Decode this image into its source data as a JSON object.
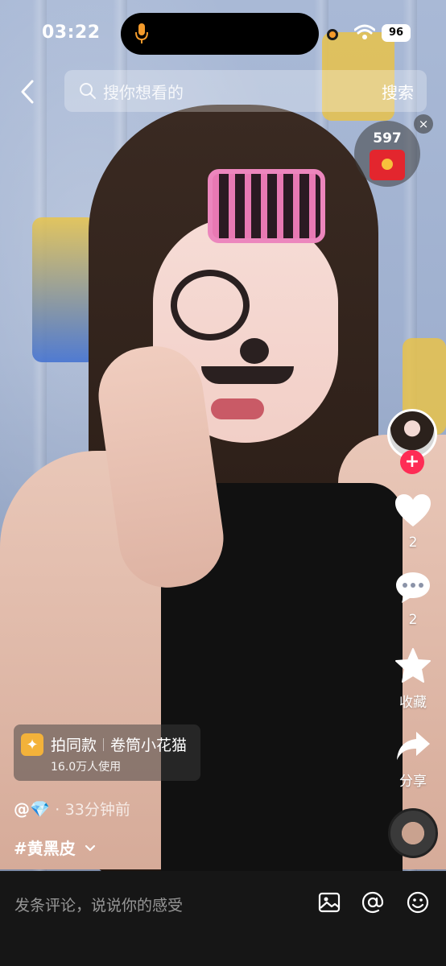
{
  "status_bar": {
    "time": "03:22",
    "battery": "96"
  },
  "search": {
    "placeholder": "搜你想看的",
    "button_label": "搜索"
  },
  "red_packet": {
    "count": "597"
  },
  "rail": {
    "like_count": "2",
    "comment_count": "2",
    "favorite_label": "收藏",
    "share_label": "分享"
  },
  "effect": {
    "title": "拍同款",
    "name": "卷筒小花猫",
    "users": "16.0万人使用"
  },
  "author": {
    "name": "@💎",
    "separator": "·",
    "time": "33分钟前"
  },
  "hashtag": {
    "label": "#黄黑皮"
  },
  "comment_bar": {
    "placeholder": "发条评论，说说你的感受"
  },
  "colors": {
    "follow": "#fe2c55",
    "accent": "#f3b23a",
    "red_packet": "#e3262e"
  }
}
